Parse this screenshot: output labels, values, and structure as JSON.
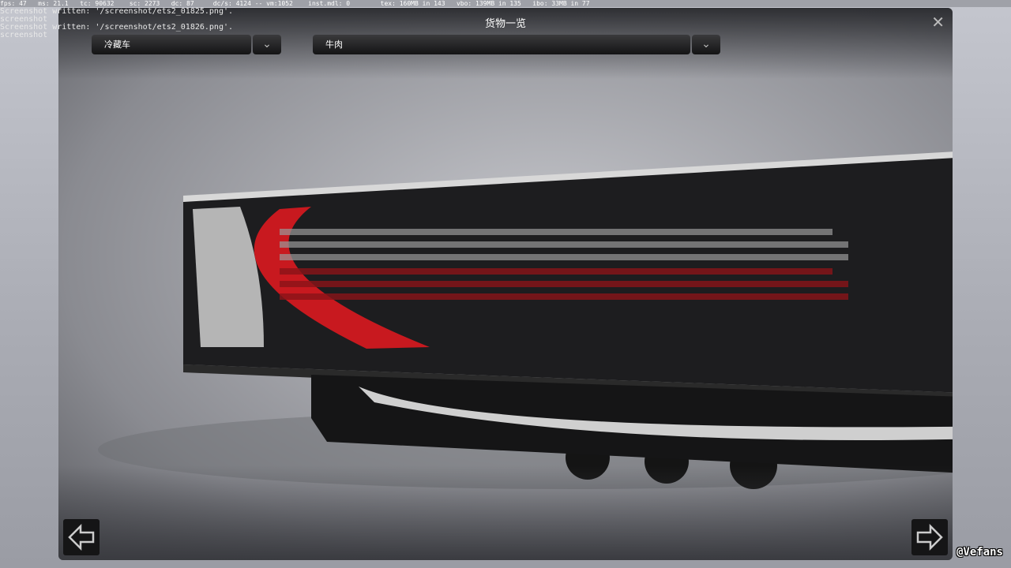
{
  "debug": {
    "stats": "fps: 47   ms: 21.1   tc: 90632    sc: 2273   dc: 87     dc/s: 4124 -- vm:1052    inst.mdl: 0        tex: 160MB in 143   vbo: 139MB in 135   ibo: 33MB in 77"
  },
  "log": [
    "Screenshot written: '/screenshot/ets2_01825.png'.",
    "screenshot",
    "Screenshot written: '/screenshot/ets2_01826.png'.",
    "screenshot"
  ],
  "window": {
    "title": "货物一览",
    "close_icon": "close-icon"
  },
  "filters": {
    "trailer_type": "冷藏车",
    "cargo": "牛肉"
  },
  "nav": {
    "prev_icon": "arrow-left-icon",
    "next_icon": "arrow-right-icon"
  },
  "watermark": "@Vefans"
}
